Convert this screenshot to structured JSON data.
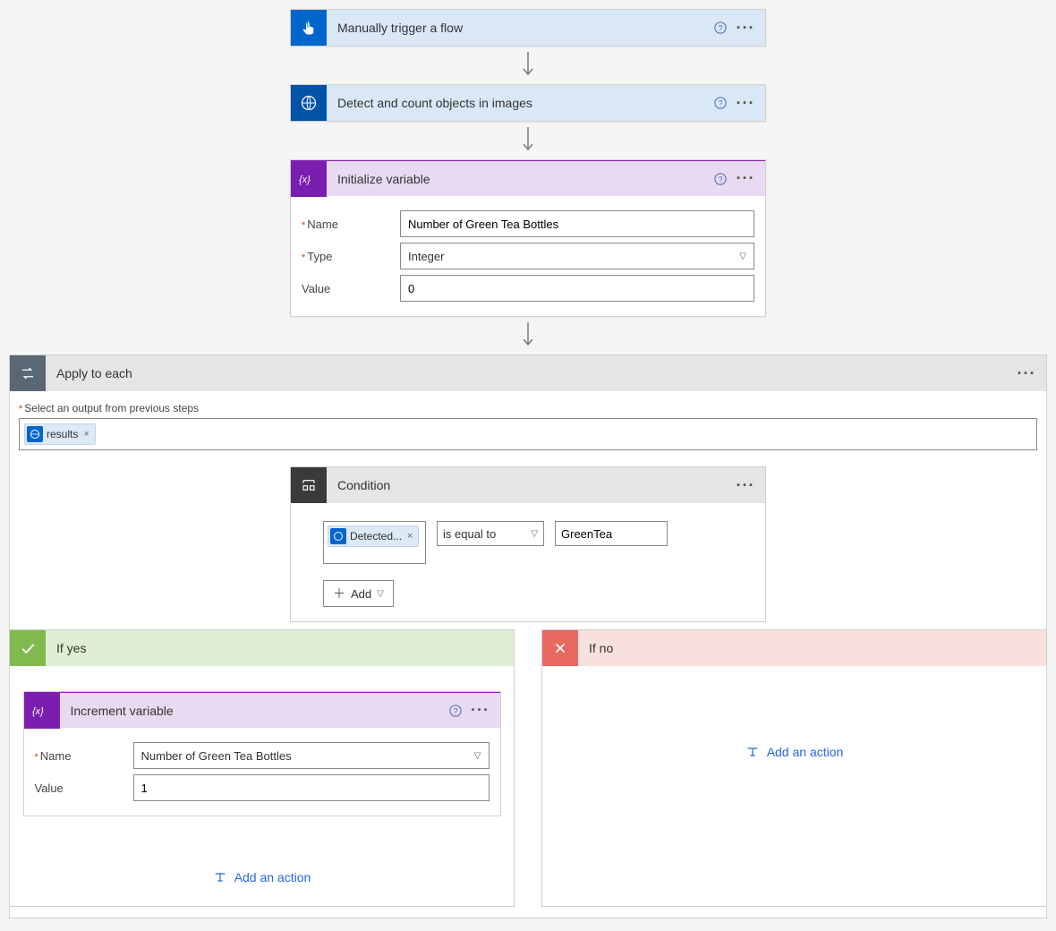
{
  "trigger": {
    "title": "Manually trigger a flow"
  },
  "detect": {
    "title": "Detect and count objects in images"
  },
  "init_var": {
    "title": "Initialize variable",
    "name_label": "Name",
    "name_value": "Number of Green Tea Bottles",
    "type_label": "Type",
    "type_value": "Integer",
    "value_label": "Value",
    "value_value": "0"
  },
  "apply_each": {
    "title": "Apply to each",
    "select_label": "Select an output from previous steps",
    "token": "results"
  },
  "condition": {
    "title": "Condition",
    "detected_token": "Detected...",
    "operator": "is equal to",
    "right_value": "GreenTea",
    "add_label": "Add"
  },
  "if_yes": {
    "title": "If yes"
  },
  "if_no": {
    "title": "If no"
  },
  "increment": {
    "title": "Increment variable",
    "name_label": "Name",
    "name_value": "Number of Green Tea Bottles",
    "value_label": "Value",
    "value_value": "1"
  },
  "add_action_label": "Add an action"
}
